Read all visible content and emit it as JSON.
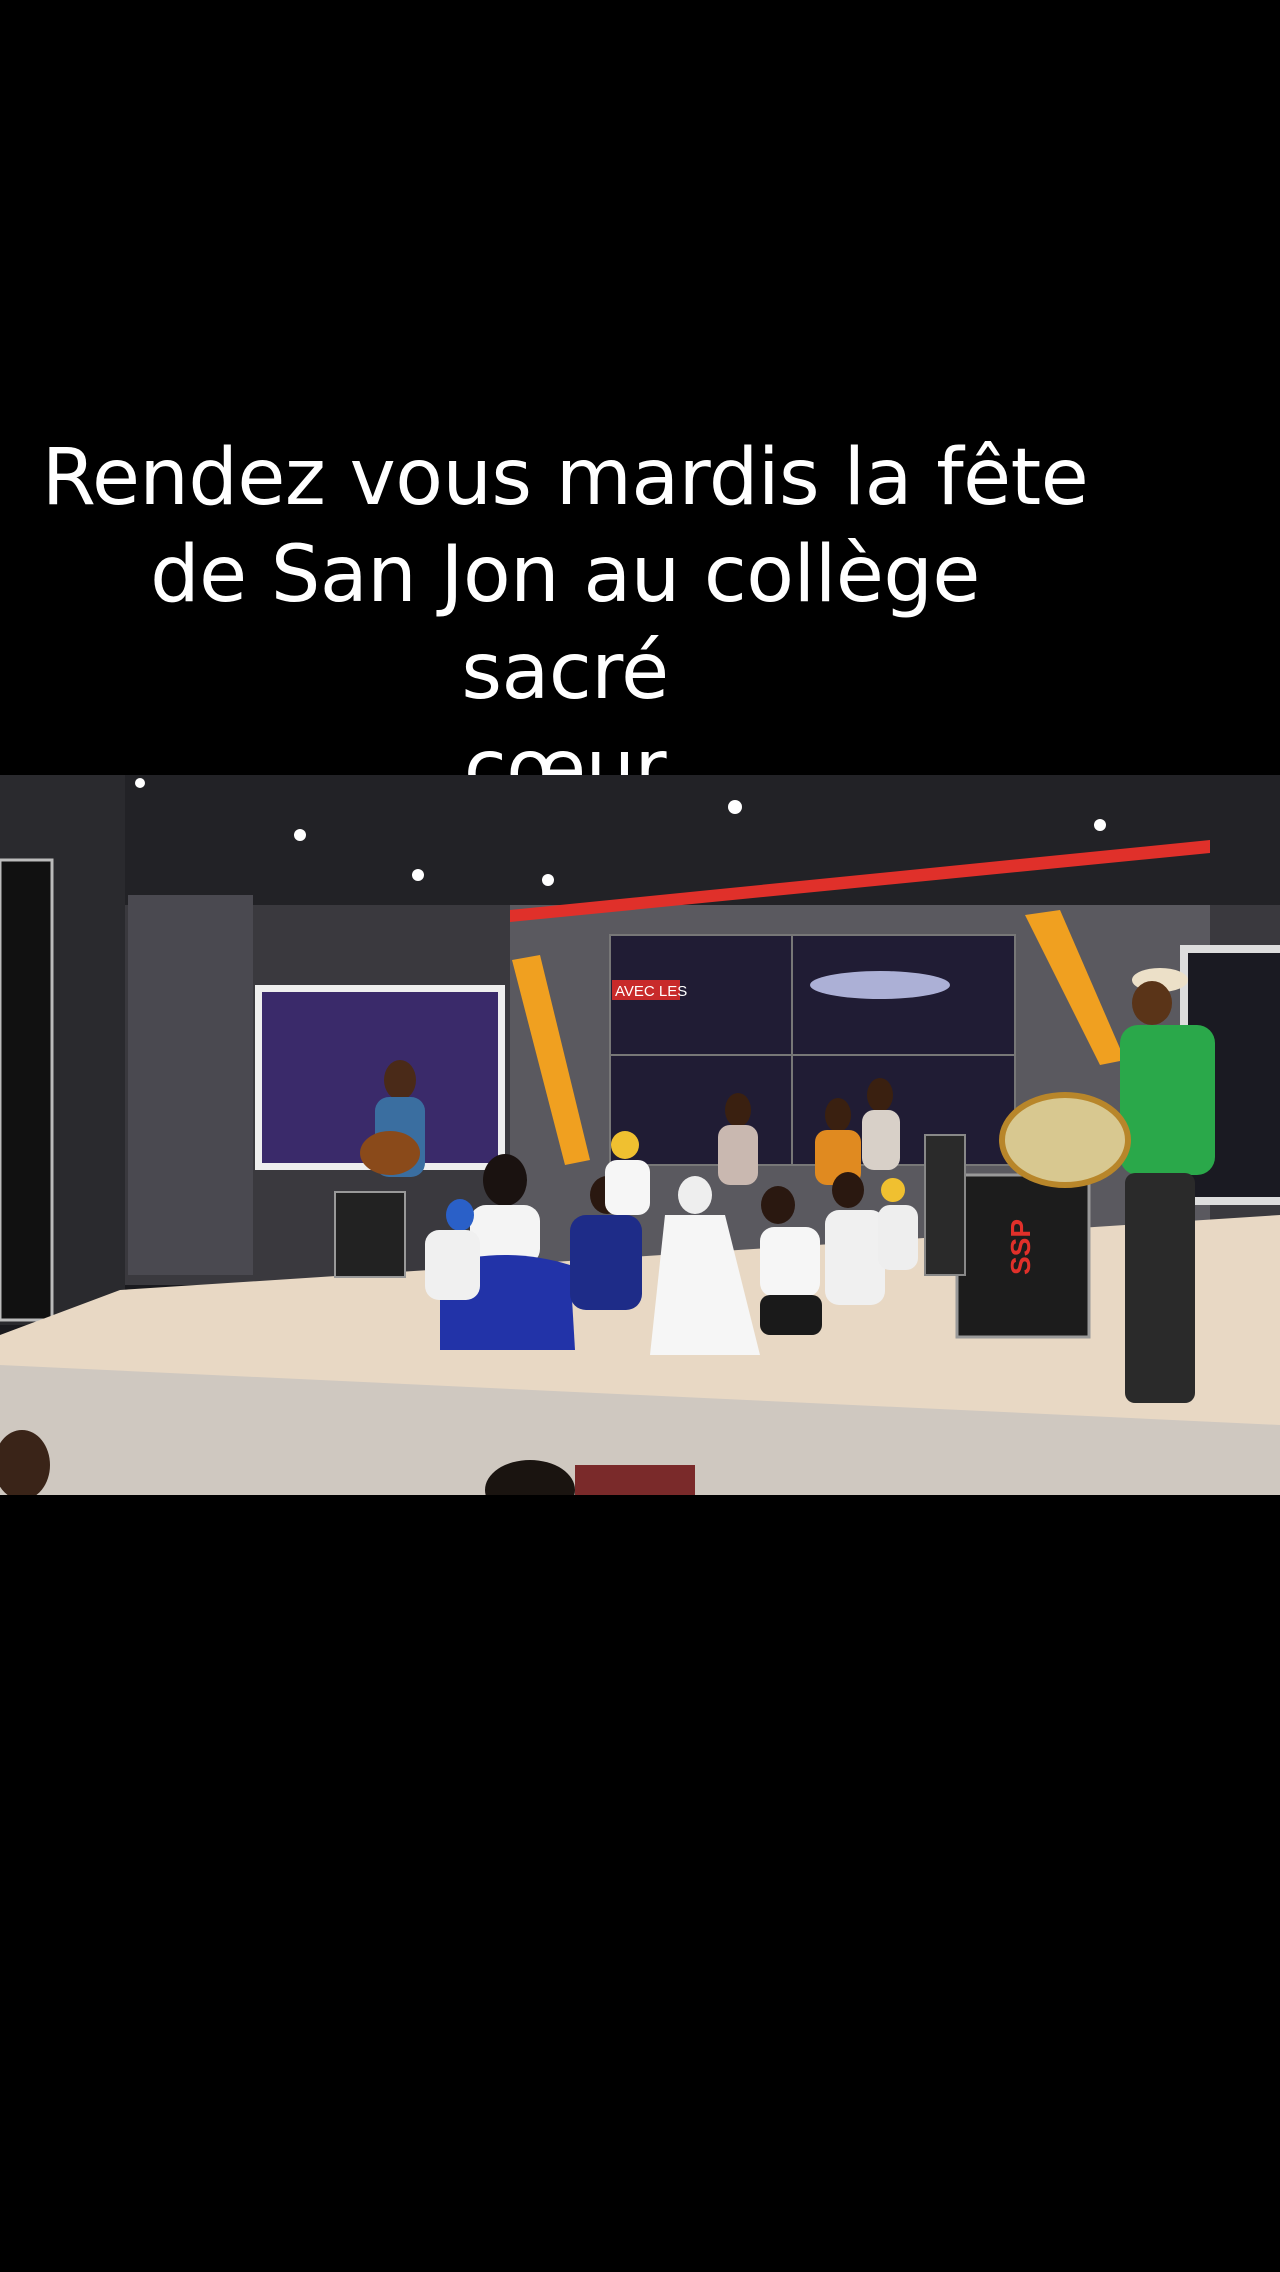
{
  "overlay": {
    "caption_lines": [
      "Rendez vous mardis la fête",
      "de San Jon au collège sacré",
      "cœur"
    ]
  },
  "scene": {
    "screen_text": "AVEC LES",
    "case_label": "SSP",
    "colors": {
      "ceiling": "#222226",
      "wall": "#55545a",
      "accent_red": "#e0302a",
      "accent_orange": "#f0a020",
      "stage_floor": "#e8d8c4",
      "screen_purple": "#3a2a6a",
      "green_shirt": "#2aa84a",
      "blue_dress": "#2233a8"
    }
  }
}
